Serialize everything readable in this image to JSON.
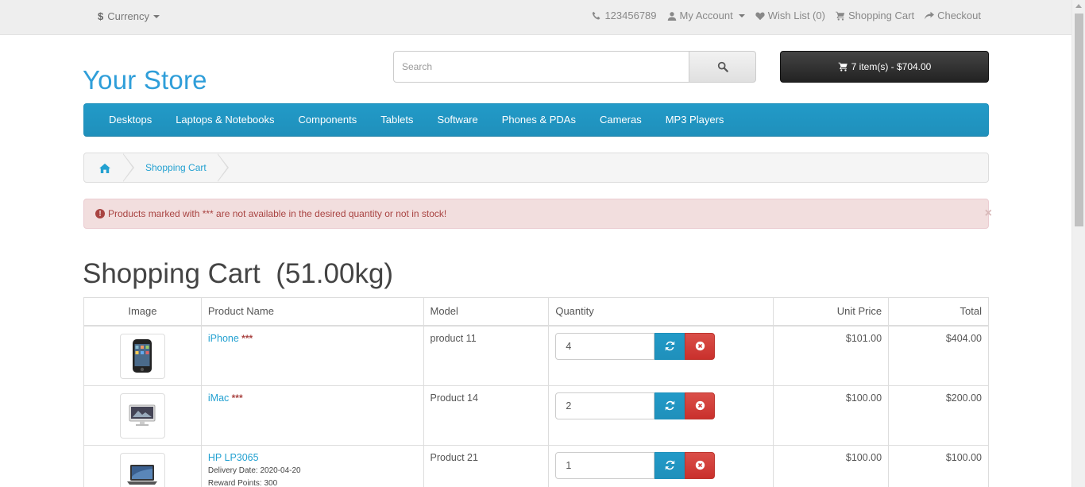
{
  "topbar": {
    "currency_symbol": "$",
    "currency_label": "Currency",
    "phone": "123456789",
    "my_account": "My Account",
    "wish_list": "Wish List (0)",
    "shopping_cart": "Shopping Cart",
    "checkout": "Checkout"
  },
  "header": {
    "logo": "Your Store",
    "search_placeholder": "Search",
    "cart_summary": "7 item(s) - $704.00"
  },
  "menu": {
    "items": [
      "Desktops",
      "Laptops & Notebooks",
      "Components",
      "Tablets",
      "Software",
      "Phones & PDAs",
      "Cameras",
      "MP3 Players"
    ]
  },
  "breadcrumb": {
    "current": "Shopping Cart"
  },
  "alert": {
    "icon": "!",
    "message": "Products marked with *** are not available in the desired quantity or not in stock!",
    "close": "×"
  },
  "page": {
    "title": "Shopping Cart  (51.00kg)"
  },
  "table": {
    "headers": {
      "image": "Image",
      "name": "Product Name",
      "model": "Model",
      "quantity": "Quantity",
      "unit_price": "Unit Price",
      "total": "Total"
    },
    "rows": [
      {
        "name": "iPhone",
        "stock_flag": "***",
        "model": "product 11",
        "quantity": "4",
        "unit_price": "$101.00",
        "total": "$404.00"
      },
      {
        "name": "iMac",
        "stock_flag": "***",
        "model": "Product 14",
        "quantity": "2",
        "unit_price": "$100.00",
        "total": "$200.00"
      },
      {
        "name": "HP LP3065",
        "stock_flag": "",
        "delivery": "Delivery Date: 2020-04-20",
        "reward": "Reward Points: 300",
        "model": "Product 21",
        "quantity": "1",
        "unit_price": "$100.00",
        "total": "$100.00"
      }
    ]
  },
  "colors": {
    "brand_blue": "#229ac8",
    "link_blue": "#23a1d1",
    "alert_bg": "#f2dede",
    "danger_red": "#da4f49"
  }
}
